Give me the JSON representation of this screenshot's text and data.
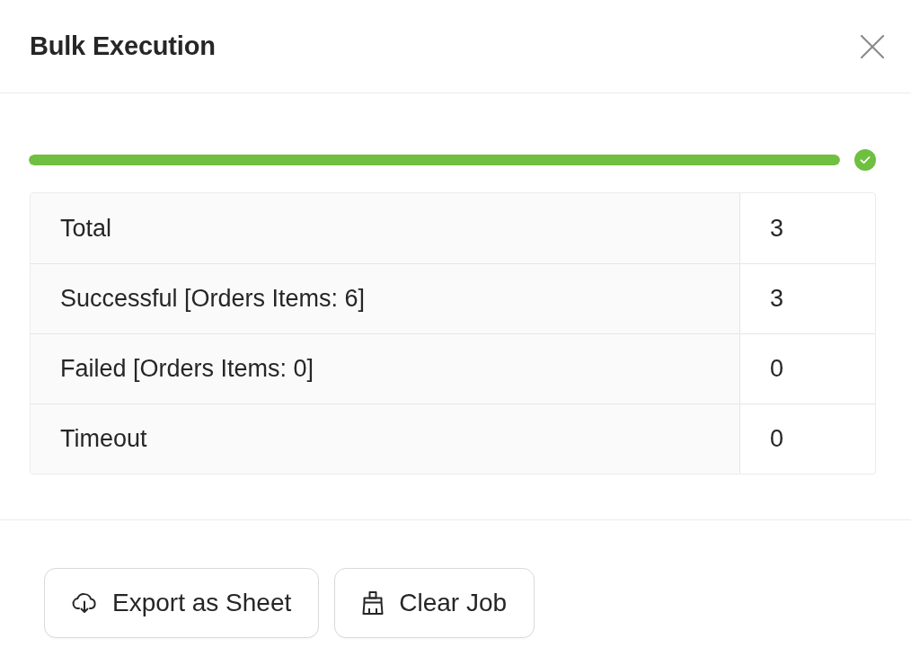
{
  "dialog": {
    "title": "Bulk Execution"
  },
  "progress": {
    "level": 1,
    "complete": true
  },
  "table": {
    "rows": [
      {
        "label": "Total",
        "value": "3"
      },
      {
        "label": "Successful [Orders Items: 6]",
        "value": "3"
      },
      {
        "label": "Failed [Orders Items: 0]",
        "value": "0"
      },
      {
        "label": "Timeout",
        "value": "0"
      }
    ]
  },
  "buttons": [
    {
      "kind": "export",
      "label": "Export as Sheet"
    },
    {
      "kind": "clear",
      "label": "Clear Job"
    }
  ]
}
